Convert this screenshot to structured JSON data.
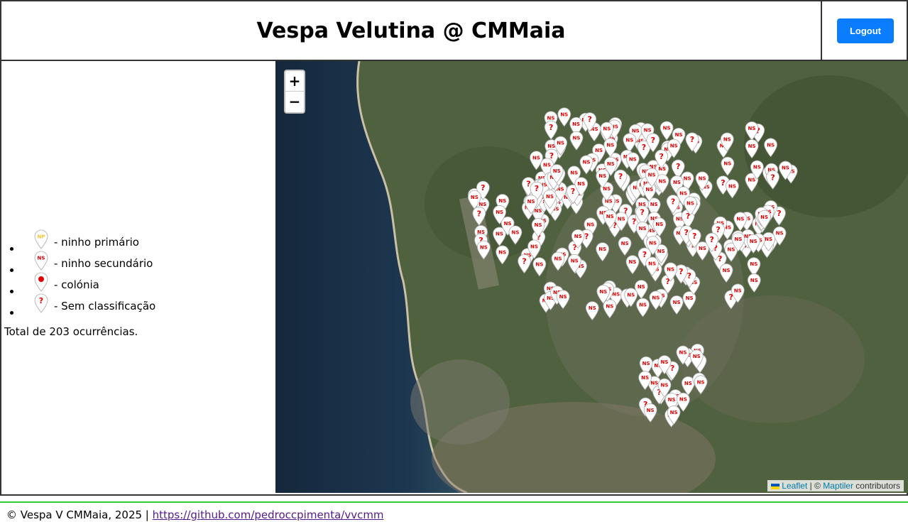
{
  "header": {
    "title": "Vespa Velutina @ CMMaia",
    "logout_label": "Logout"
  },
  "legend": {
    "items": [
      {
        "icon": "pin-np-icon",
        "badge": "NP",
        "badge_color": "#f4c430",
        "label": " - ninho primário"
      },
      {
        "icon": "pin-ns-icon",
        "badge": "NS",
        "badge_color": "#e00000",
        "label": " - ninho secundário"
      },
      {
        "icon": "pin-colony-icon",
        "badge": "●",
        "badge_color": "#e00000",
        "label": " - colónia"
      },
      {
        "icon": "pin-unclassified-icon",
        "badge": "?",
        "badge_color": "#e00000",
        "label": " - Sem classificação"
      }
    ],
    "total_text": "Total de 203 ocurrências."
  },
  "map": {
    "zoom_in_label": "+",
    "zoom_out_label": "−",
    "attribution_leaflet": "Leaflet",
    "attribution_sep": " | © ",
    "attribution_maptiler": "Maptiler",
    "attribution_contributors": " contributors",
    "marker_colors": {
      "pin": "#ffffff",
      "badge": "#e00000",
      "primary": "#f4c430"
    }
  },
  "footer": {
    "text": "© Vespa V CMMaia, 2025 | ",
    "link": "https://github.com/pedroccpimenta/vvcmm"
  }
}
